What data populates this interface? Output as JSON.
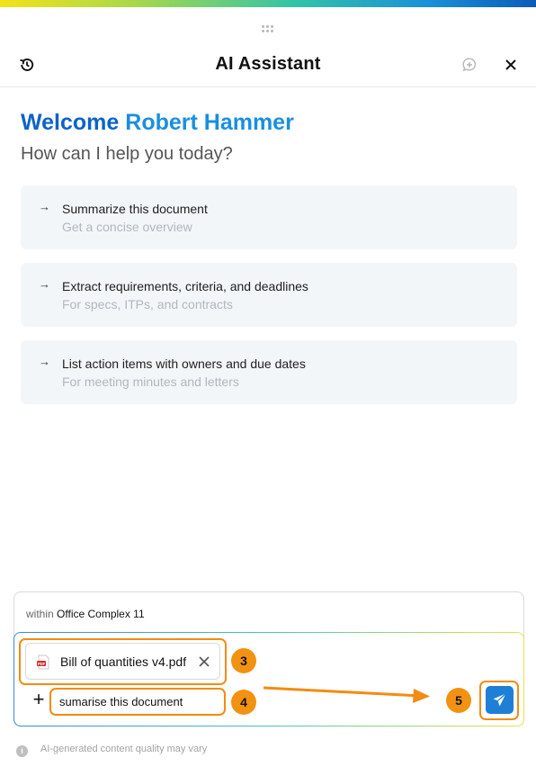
{
  "header": {
    "title": "AI Assistant",
    "history_icon": "history-icon",
    "new_chat_icon": "new-chat-icon",
    "close_icon": "close-icon"
  },
  "welcome": {
    "greeting": "Welcome",
    "user_name": "Robert Hammer",
    "subtitle": "How can I help you today?"
  },
  "suggestions": [
    {
      "title": "Summarize this document",
      "subtitle": "Get a concise overview"
    },
    {
      "title": "Extract requirements, criteria, and deadlines",
      "subtitle": "For specs, ITPs, and contracts"
    },
    {
      "title": "List action items with owners and due dates",
      "subtitle": "For meeting minutes and letters"
    }
  ],
  "composer": {
    "scope_prefix": "within",
    "scope_project": "Office Complex 11",
    "attachment": {
      "file_name": "Bill of quantities v4.pdf",
      "file_type_icon": "pdf-file-icon"
    },
    "message_value": "sumarise this document",
    "send_icon": "paper-plane-icon"
  },
  "callouts": [
    "3",
    "4",
    "5"
  ],
  "footer": {
    "disclaimer": "AI-generated content quality may vary"
  },
  "colors": {
    "brand_blue": "#0b63c9",
    "name_blue": "#1a8fe0",
    "send_button": "#1f7fd6",
    "highlight_orange": "#f28c12",
    "card_bg": "#f3f6f9"
  }
}
